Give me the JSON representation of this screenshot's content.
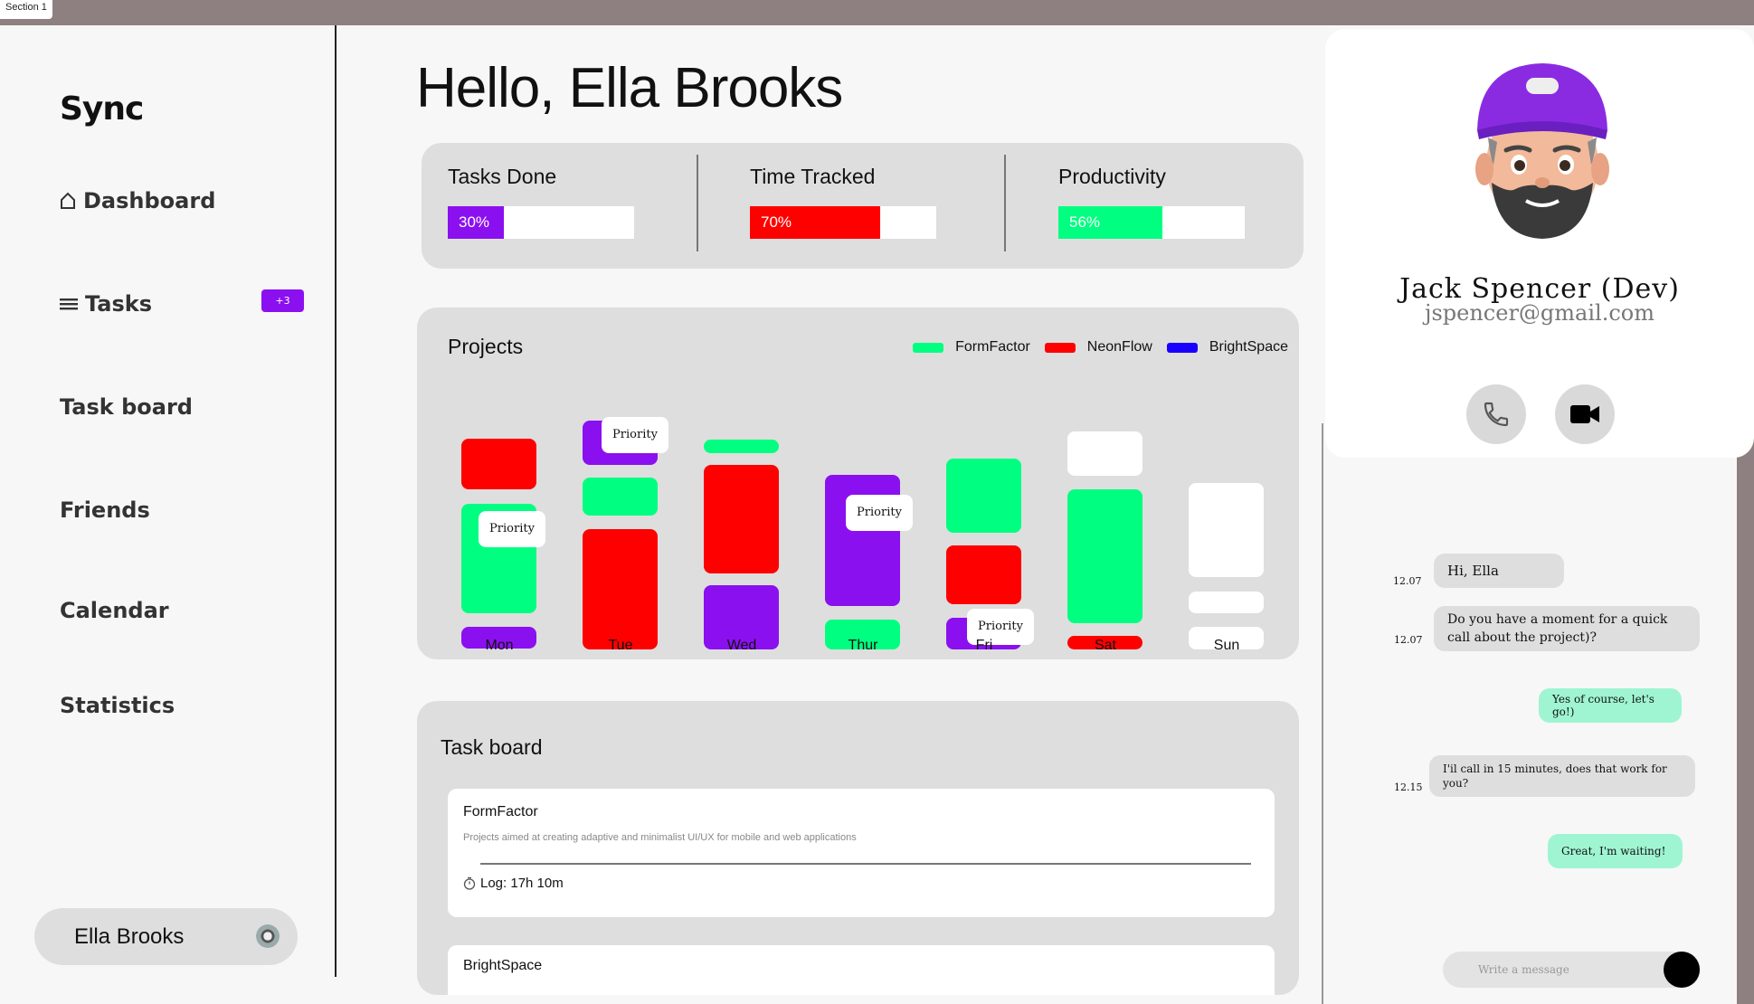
{
  "section_label": "Section 1",
  "brand": "Sync",
  "nav": [
    {
      "label": "Dashboard",
      "icon": "home-icon"
    },
    {
      "label": "Tasks",
      "icon": "menu-icon",
      "badge": "+3"
    },
    {
      "label": "Task board"
    },
    {
      "label": "Friends"
    },
    {
      "label": "Calendar"
    },
    {
      "label": "Statistics"
    }
  ],
  "user": {
    "name": "Ella Brooks"
  },
  "greeting": "Hello, Ella Brooks",
  "stats": [
    {
      "label": "Tasks Done",
      "value_text": "30%",
      "value": 0.3,
      "color": "#8b10f0"
    },
    {
      "label": "Time Tracked",
      "value_text": "70%",
      "value": 0.7,
      "color": "#ff0000"
    },
    {
      "label": "Productivity",
      "value_text": "56%",
      "value": 0.56,
      "color": "#00ff80"
    }
  ],
  "projects": {
    "title": "Projects",
    "legend": [
      {
        "name": "FormFactor",
        "color": "#00ff80"
      },
      {
        "name": "NeonFlow",
        "color": "#ff0000"
      },
      {
        "name": "BrightSpace",
        "color": "#1a00ff"
      }
    ],
    "days": [
      "Mon",
      "Tue",
      "Wed",
      "Thur",
      "Fri",
      "Sat",
      "Sun"
    ],
    "priority_label": "Priority"
  },
  "taskboard": {
    "title": "Task board",
    "tasks": [
      {
        "name": "FormFactor",
        "description": "Projects aimed at creating adaptive and minimalist UI/UX for mobile and web applications",
        "log": "Log: 17h 10m"
      },
      {
        "name": "BrightSpace"
      }
    ]
  },
  "profile": {
    "name": "Jack Spencer (Dev)",
    "email": "jspencer@gmail.com"
  },
  "chat": {
    "messages": [
      {
        "from": "them",
        "time": "12.07",
        "text": "Hi, Ella"
      },
      {
        "from": "them",
        "time": "12.07",
        "text": "Do you have a moment for a quick call about the project)?"
      },
      {
        "from": "me",
        "text": "Yes of course, let's go!)"
      },
      {
        "from": "them",
        "time": "12.15",
        "text": "I'il call in 15 minutes, does that work for you?"
      },
      {
        "from": "me",
        "text": "Great, I'm waiting!"
      }
    ],
    "placeholder": "Write a message"
  }
}
